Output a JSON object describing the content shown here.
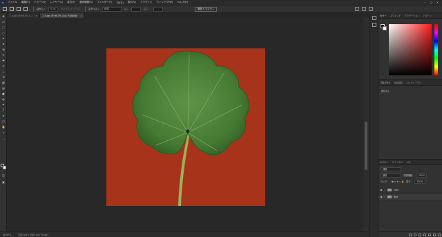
{
  "app": {
    "logo": "Ps",
    "menu": [
      "ファイル",
      "編集(E)",
      "イメージ(I)",
      "レイヤー(L)",
      "書式(Y)",
      "選択範囲(S)",
      "フィルター(T)",
      "3D(D)",
      "表示(V)",
      "プラグイン",
      "ウィンドウ(W)",
      "ヘルプ(H)"
    ],
    "window_controls": [
      "–",
      "□",
      "✕"
    ]
  },
  "options_bar": {
    "feather_label": "ぼかし：",
    "feather_value": "0 px",
    "antialias_label": "アンチエイリアス",
    "style_label": "スタイル：",
    "style_value": "標準",
    "width_label": "幅：",
    "height_label": "高さ：",
    "select_mask_label": "選択とマスク..."
  },
  "doc_tabs": [
    {
      "label": "7_5.psd @ 66.7% (...)",
      "active": false,
      "close": "×"
    },
    {
      "label": "7_5.psd @ 66.7% (Cut, RGB/8#)",
      "active": true,
      "close": "×"
    }
  ],
  "status": {
    "zoom": "66.67%",
    "doc_info": "2084 px x 2084 px (72 ppi)"
  },
  "color_panel": {
    "tabs": [
      "カラー",
      "スウォッチ",
      "グラデーション",
      "パターン"
    ],
    "active_tab": 0,
    "foreground": "#000000",
    "background": "#ffffff"
  },
  "properties_panel": {
    "tabs": [
      "プロパティ",
      "色調補正",
      "CC ライブラリ"
    ],
    "active_tab": 0,
    "empty_text": "属性なし"
  },
  "layers_panel": {
    "tabs": [
      "レイヤー",
      "チャンネル",
      "パス"
    ],
    "active_tab": 0,
    "search_placeholder": "種類",
    "blend_mode": "通常",
    "opacity_label": "不透明度：",
    "opacity_value": "100%",
    "lock_label": "ロック：",
    "fill_label": "塗り：",
    "fill_value": "100%",
    "layers": [
      {
        "name": "Leaf",
        "visible": true
      },
      {
        "name": "Bgd",
        "visible": true
      }
    ]
  },
  "document": {
    "background_color": "#a8331b",
    "leaf_color": "#4a7d37",
    "stem_color": "#9ab35b"
  }
}
